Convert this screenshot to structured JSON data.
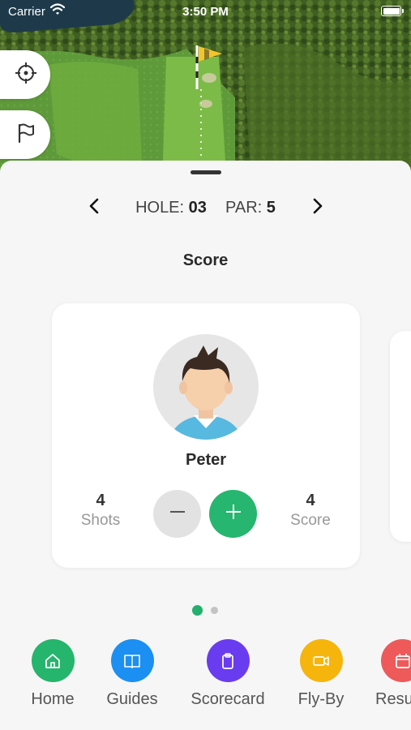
{
  "status_bar": {
    "carrier": "Carrier",
    "time": "3:50 PM"
  },
  "map": {
    "buttons": [
      {
        "icon": "crosshair-icon"
      },
      {
        "icon": "flag-icon"
      }
    ]
  },
  "hole_nav": {
    "hole_label": "HOLE:",
    "hole_value": "03",
    "par_label": "PAR:",
    "par_value": "5"
  },
  "section_title": "Score",
  "player_card": {
    "name": "Peter",
    "shots_value": "4",
    "shots_label": "Shots",
    "score_value": "4",
    "score_label": "Score"
  },
  "pagination": {
    "pages": 2,
    "active": 0
  },
  "nav": {
    "items": [
      {
        "label": "Home",
        "icon": "home-icon",
        "color": "#25b56c"
      },
      {
        "label": "Guides",
        "icon": "book-icon",
        "color": "#1b8ff2"
      },
      {
        "label": "Scorecard",
        "icon": "clipboard-icon",
        "color": "#6a3cf0"
      },
      {
        "label": "Fly-By",
        "icon": "video-camera-icon",
        "color": "#f5b50c"
      },
      {
        "label": "Resu",
        "icon": "calendar-icon",
        "color": "#ee5a5a"
      }
    ]
  },
  "colors": {
    "accent_green": "#25b56c",
    "sheet_background": "#f6f6f6"
  }
}
